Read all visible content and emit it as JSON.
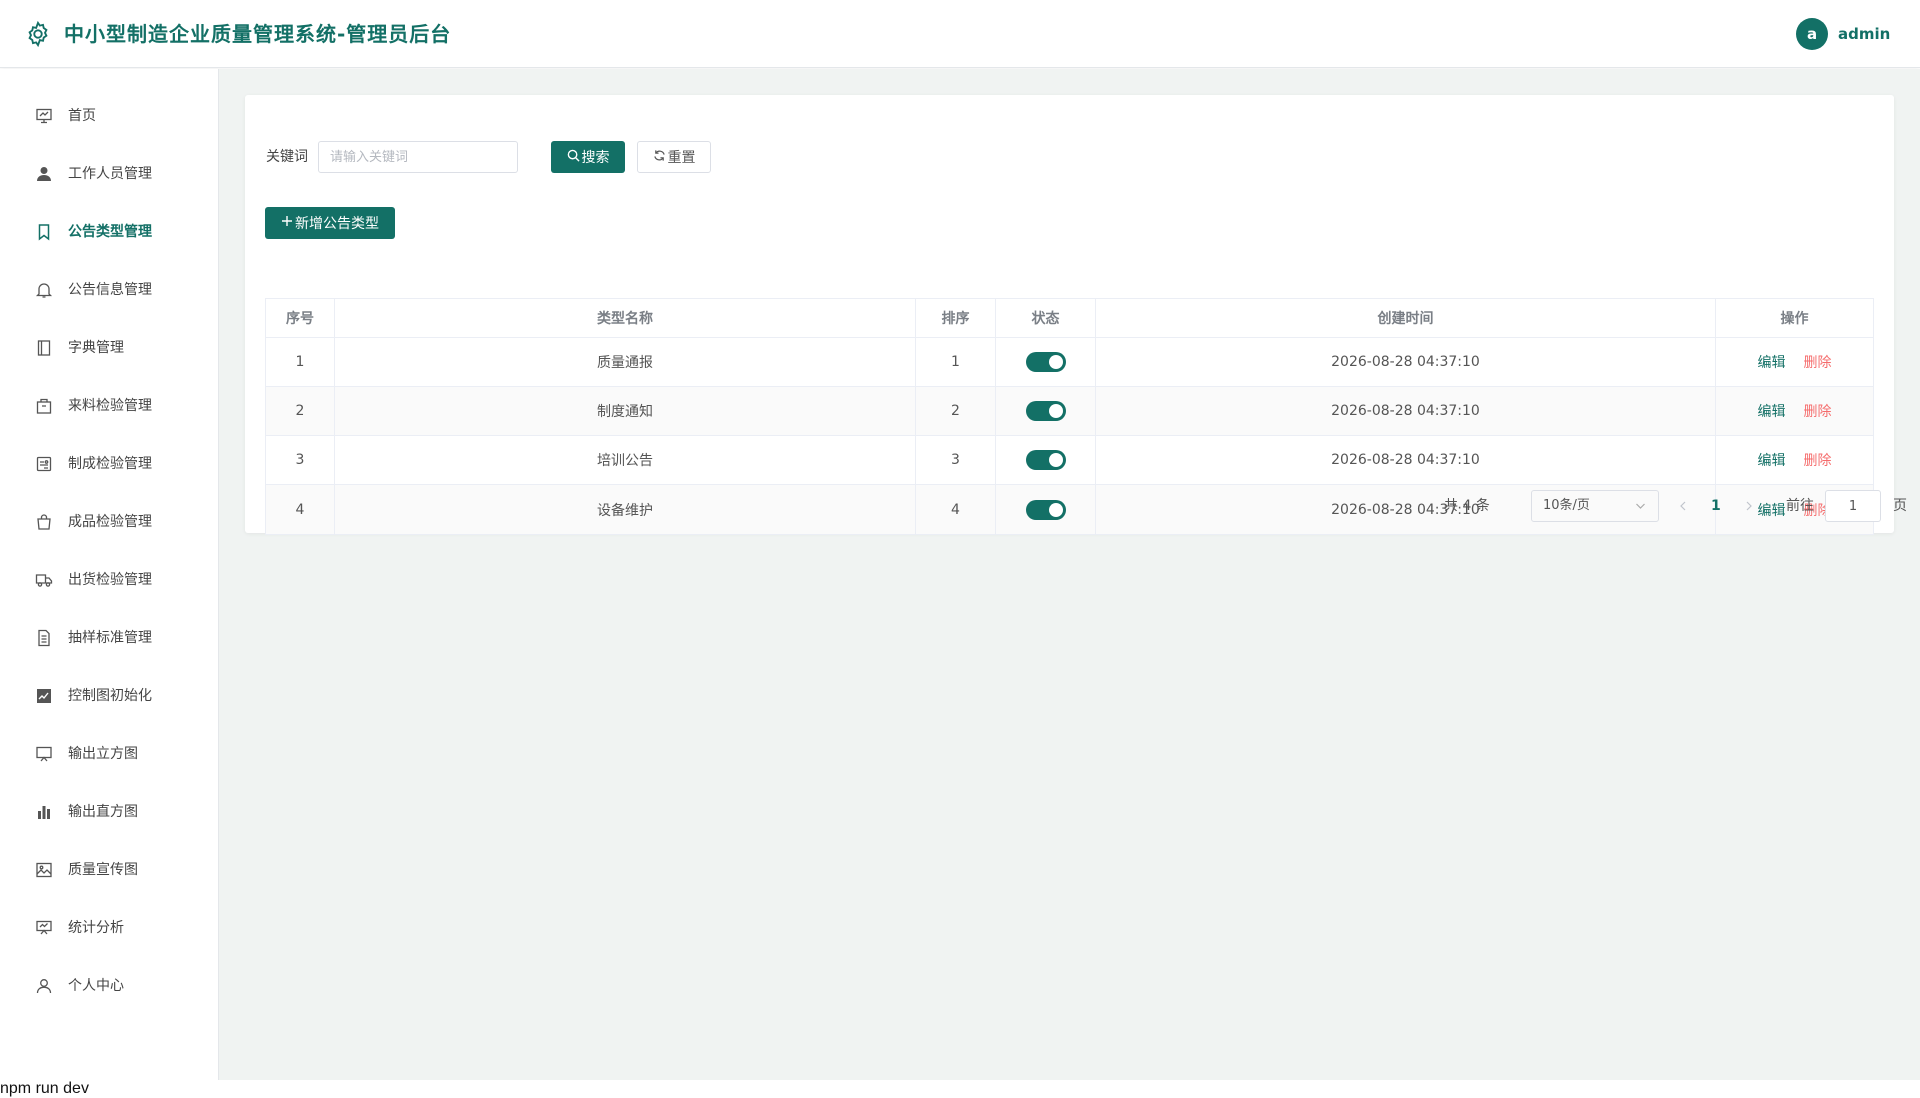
{
  "header": {
    "title": "中小型制造企业质量管理系统-管理员后台",
    "avatar_letter": "a",
    "username": "admin"
  },
  "sidebar": {
    "items": [
      {
        "label": "首页",
        "icon": "dashboard-icon",
        "active": false
      },
      {
        "label": "工作人员管理",
        "icon": "user-icon",
        "active": false
      },
      {
        "label": "公告类型管理",
        "icon": "bookmark-icon",
        "active": true
      },
      {
        "label": "公告信息管理",
        "icon": "bell-icon",
        "active": false
      },
      {
        "label": "字典管理",
        "icon": "book-icon",
        "active": false
      },
      {
        "label": "来料检验管理",
        "icon": "box-icon",
        "active": false
      },
      {
        "label": "制成检验管理",
        "icon": "tray-icon",
        "active": false
      },
      {
        "label": "成品检验管理",
        "icon": "bag-icon",
        "active": false
      },
      {
        "label": "出货检验管理",
        "icon": "truck-icon",
        "active": false
      },
      {
        "label": "抽样标准管理",
        "icon": "document-icon",
        "active": false
      },
      {
        "label": "控制图初始化",
        "icon": "trend-chart-icon",
        "active": false
      },
      {
        "label": "输出立方图",
        "icon": "monitor-icon",
        "active": false
      },
      {
        "label": "输出直方图",
        "icon": "histogram-icon",
        "active": false
      },
      {
        "label": "质量宣传图",
        "icon": "picture-icon",
        "active": false
      },
      {
        "label": "统计分析",
        "icon": "presentation-icon",
        "active": false
      },
      {
        "label": "个人中心",
        "icon": "person-icon",
        "active": false
      }
    ]
  },
  "search": {
    "label": "关键词",
    "placeholder": "请输入关键词",
    "value": "",
    "search_label": "搜索",
    "reset_label": "重置"
  },
  "toolbar": {
    "add_label": "新增公告类型"
  },
  "table": {
    "columns": [
      "序号",
      "类型名称",
      "排序",
      "状态",
      "创建时间",
      "操作"
    ],
    "rows": [
      {
        "index": "1",
        "name": "质量通报",
        "sort": "1",
        "status": true,
        "created": "2026-08-28 04:37:10"
      },
      {
        "index": "2",
        "name": "制度通知",
        "sort": "2",
        "status": true,
        "created": "2026-08-28 04:37:10"
      },
      {
        "index": "3",
        "name": "培训公告",
        "sort": "3",
        "status": true,
        "created": "2026-08-28 04:37:10"
      },
      {
        "index": "4",
        "name": "设备维护",
        "sort": "4",
        "status": true,
        "created": "2026-08-28 04:37:10"
      }
    ],
    "edit_label": "编辑",
    "delete_label": "删除"
  },
  "pagination": {
    "total_text": "共 4 条",
    "page_size": "10条/页",
    "current_page": "1",
    "goto_label": "前往",
    "goto_value": "1",
    "page_suffix": "页"
  },
  "footer": {
    "terminal_text": "npm run dev"
  },
  "colors": {
    "primary": "#137066",
    "danger": "#f56c6c",
    "background": "#f0f3f2"
  }
}
